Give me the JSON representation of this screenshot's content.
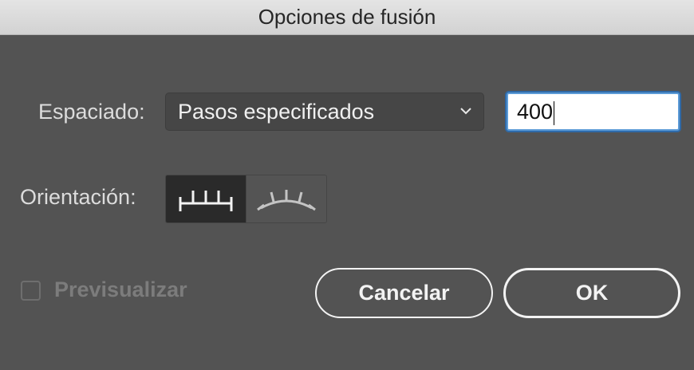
{
  "window": {
    "title": "Opciones de fusión"
  },
  "spacing": {
    "label": "Espaciado:",
    "selected_option": "Pasos especificados",
    "value": "400"
  },
  "orientation": {
    "label": "Orientación:",
    "options": [
      {
        "id": "align-to-page",
        "icon": "align-to-page-icon",
        "selected": true
      },
      {
        "id": "align-to-path",
        "icon": "align-to-path-icon",
        "selected": false
      }
    ]
  },
  "preview": {
    "label": "Previsualizar",
    "checked": false,
    "enabled": false
  },
  "buttons": {
    "cancel": "Cancelar",
    "ok": "OK"
  },
  "colors": {
    "dialog_bg": "#535353",
    "titlebar_bg": "#d8d8d8",
    "focus_ring": "#5b9ad6",
    "selected_toggle_bg": "#2a2a2a"
  }
}
